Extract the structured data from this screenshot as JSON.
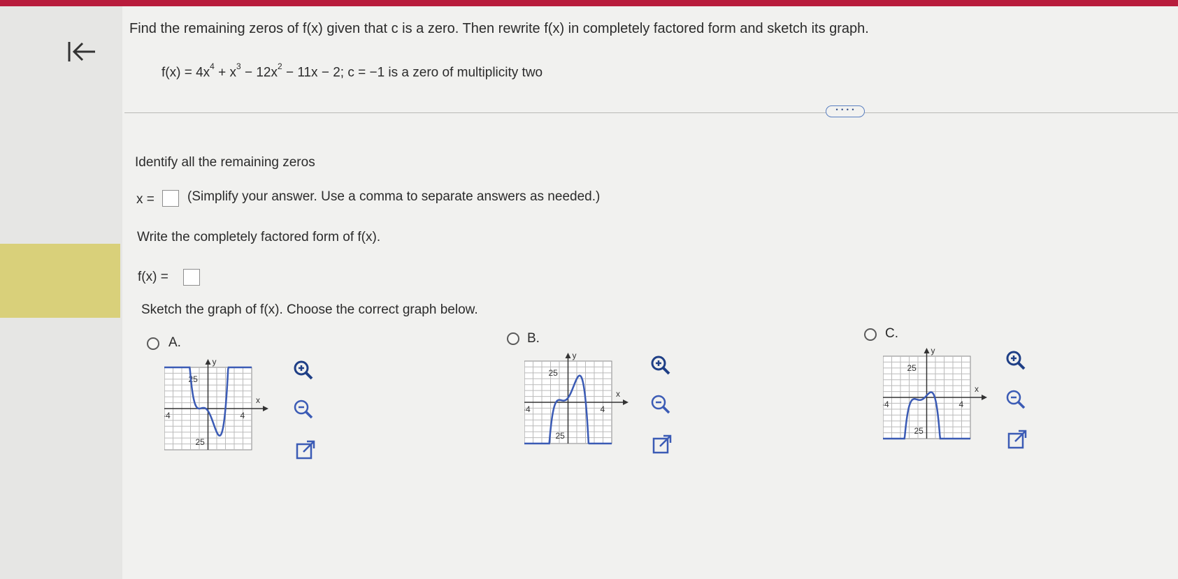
{
  "question": {
    "instruction": "Find the remaining zeros of f(x) given that c is a zero. Then rewrite f(x) in completely factored form and sketch its graph.",
    "eq_prefix": "f(x) = 4x",
    "exp4": "4",
    "eq_p2": " + x",
    "exp3": "3",
    "eq_p3": " − 12x",
    "exp2": "2",
    "eq_p4": " − 11x − 2; c = −1 is a zero of multiplicity two"
  },
  "more_label": "• • • •",
  "part1": {
    "prompt": "Identify all the remaining zeros",
    "var_label": "x =",
    "note": "(Simplify your answer. Use a comma to separate answers as needed.)",
    "answer": ""
  },
  "part2": {
    "prompt": "Write the completely factored form of f(x).",
    "var_label": "f(x) =",
    "answer": ""
  },
  "part3": {
    "prompt": "Sketch the graph of f(x). Choose the correct graph below.",
    "options": [
      {
        "letter": "A.",
        "ytick": "25",
        "ytick_neg": "-25",
        "xtick_neg": "-4",
        "xtick_pos": "4",
        "x_axis": "x",
        "y_axis": "y"
      },
      {
        "letter": "B.",
        "ytick": "25",
        "ytick_neg": "-25",
        "xtick_neg": "-4",
        "xtick_pos": "4",
        "x_axis": "x",
        "y_axis": "y"
      },
      {
        "letter": "C.",
        "ytick": "25",
        "ytick_neg": "-25",
        "xtick_neg": "-4",
        "xtick_pos": "4",
        "x_axis": "x",
        "y_axis": "y"
      }
    ]
  },
  "icons": [
    "back-arrow-icon",
    "zoom-in-icon",
    "zoom-out-icon",
    "open-external-icon"
  ],
  "colors": {
    "topbar": "#b81c3c",
    "accent": "#d9d07a",
    "curve": "#3b5bb5",
    "link": "#34508a"
  }
}
